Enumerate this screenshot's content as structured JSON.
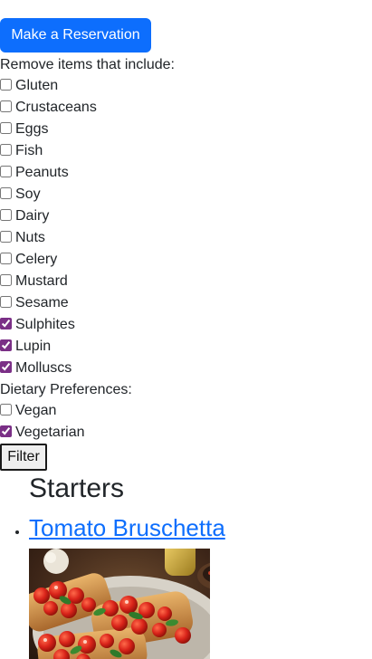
{
  "actions": {
    "reserve_label": "Make a Reservation"
  },
  "filters": {
    "allergen_heading": "Remove items that include:",
    "allergens": [
      {
        "label": "Gluten",
        "checked": false
      },
      {
        "label": "Crustaceans",
        "checked": false
      },
      {
        "label": "Eggs",
        "checked": false
      },
      {
        "label": "Fish",
        "checked": false
      },
      {
        "label": "Peanuts",
        "checked": false
      },
      {
        "label": "Soy",
        "checked": false
      },
      {
        "label": "Dairy",
        "checked": false
      },
      {
        "label": "Nuts",
        "checked": false
      },
      {
        "label": "Celery",
        "checked": false
      },
      {
        "label": "Mustard",
        "checked": false
      },
      {
        "label": "Sesame",
        "checked": false
      },
      {
        "label": "Sulphites",
        "checked": true
      },
      {
        "label": "Lupin",
        "checked": true
      },
      {
        "label": "Molluscs",
        "checked": true
      }
    ],
    "diet_heading": "Dietary Preferences:",
    "diets": [
      {
        "label": "Vegan",
        "checked": false
      },
      {
        "label": "Vegetarian",
        "checked": true
      }
    ],
    "submit_label": "Filter"
  },
  "menu": {
    "section_title": "Starters",
    "items": [
      {
        "name": "Tomato Bruschetta"
      }
    ]
  },
  "colors": {
    "primary": "#0d6efd",
    "checkbox_accent": "#7a2f86",
    "text": "#212529"
  }
}
